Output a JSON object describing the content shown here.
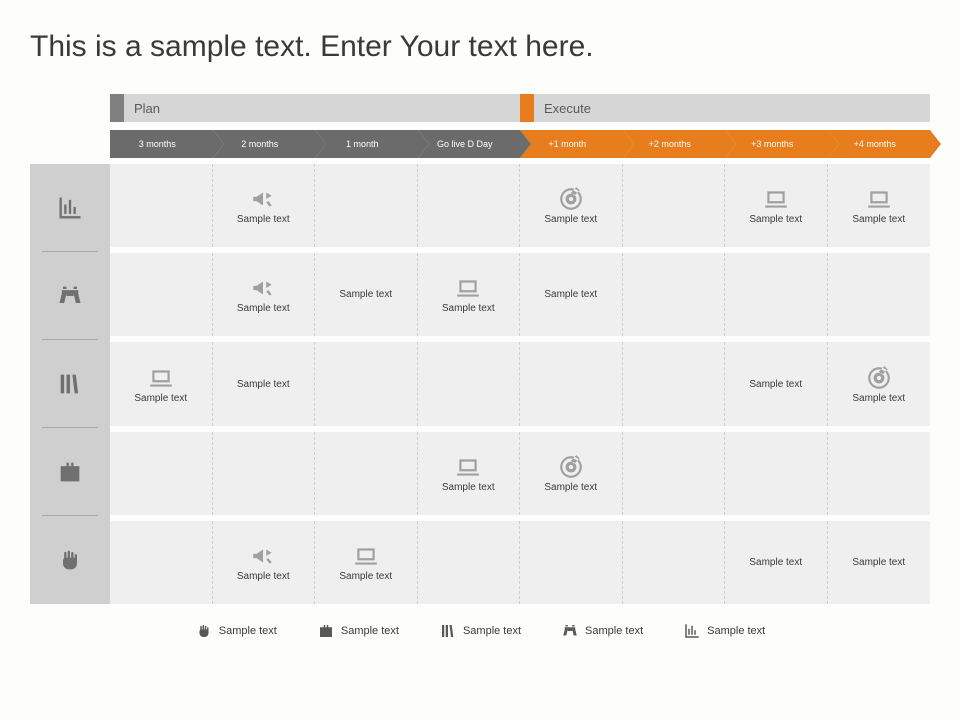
{
  "title": "This is a sample text. Enter Your text here.",
  "phases": {
    "plan": "Plan",
    "execute": "Execute"
  },
  "timeline": [
    {
      "label": "3 months",
      "tone": "gray"
    },
    {
      "label": "2 months",
      "tone": "gray"
    },
    {
      "label": "1 month",
      "tone": "gray"
    },
    {
      "label": "Go live D Day",
      "tone": "gray"
    },
    {
      "label": "+1 month",
      "tone": "orange"
    },
    {
      "label": "+2 months",
      "tone": "orange"
    },
    {
      "label": "+3 months",
      "tone": "orange"
    },
    {
      "label": "+4 months",
      "tone": "orange"
    }
  ],
  "rowIcons": [
    "bar-chart",
    "binoculars",
    "books",
    "briefcase",
    "fist"
  ],
  "matrix": [
    [
      null,
      {
        "icon": "megaphone",
        "label": "Sample text"
      },
      null,
      null,
      {
        "icon": "target",
        "label": "Sample text"
      },
      null,
      {
        "icon": "laptop",
        "label": "Sample text"
      },
      {
        "icon": "laptop",
        "label": "Sample text"
      }
    ],
    [
      null,
      {
        "icon": "megaphone",
        "label": "Sample text"
      },
      {
        "icon": null,
        "label": "Sample text"
      },
      {
        "icon": "laptop",
        "label": "Sample text"
      },
      {
        "icon": null,
        "label": "Sample text"
      },
      null,
      null,
      null
    ],
    [
      {
        "icon": "laptop",
        "label": "Sample text"
      },
      {
        "icon": null,
        "label": "Sample text"
      },
      null,
      null,
      null,
      null,
      {
        "icon": null,
        "label": "Sample text"
      },
      {
        "icon": "target",
        "label": "Sample text"
      }
    ],
    [
      null,
      null,
      null,
      {
        "icon": "laptop",
        "label": "Sample text"
      },
      {
        "icon": "target",
        "label": "Sample text"
      },
      null,
      null,
      null
    ],
    [
      null,
      {
        "icon": "megaphone",
        "label": "Sample text"
      },
      {
        "icon": "laptop",
        "label": "Sample text"
      },
      null,
      null,
      null,
      {
        "icon": null,
        "label": "Sample text"
      },
      {
        "icon": null,
        "label": "Sample text"
      }
    ]
  ],
  "legend": [
    {
      "icon": "fist",
      "label": "Sample text"
    },
    {
      "icon": "briefcase",
      "label": "Sample text"
    },
    {
      "icon": "books",
      "label": "Sample text"
    },
    {
      "icon": "binoculars",
      "label": "Sample text"
    },
    {
      "icon": "bar-chart",
      "label": "Sample text"
    }
  ]
}
